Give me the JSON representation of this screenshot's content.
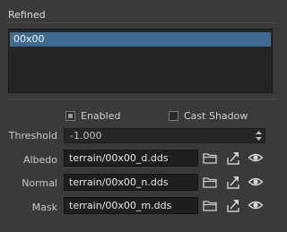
{
  "group": {
    "title": "Refined"
  },
  "list": {
    "items": [
      "00x00"
    ]
  },
  "options": {
    "enabled_label": "Enabled",
    "enabled_checked": true,
    "cast_shadow_label": "Cast Shadow",
    "cast_shadow_checked": false
  },
  "threshold": {
    "label": "Threshold",
    "value": "-1.000"
  },
  "albedo": {
    "label": "Albedo",
    "value": "terrain/00x00_d.dds"
  },
  "normal": {
    "label": "Normal",
    "value": "terrain/00x00_n.dds"
  },
  "mask": {
    "label": "Mask",
    "value": "terrain/00x00_m.dds"
  },
  "icons": {
    "browse": "folder-icon",
    "export": "export-icon",
    "view": "eye-icon"
  },
  "colors": {
    "background": "#3a3a3a",
    "selection": "#3e6b8f",
    "field": "#1f1f1f"
  }
}
